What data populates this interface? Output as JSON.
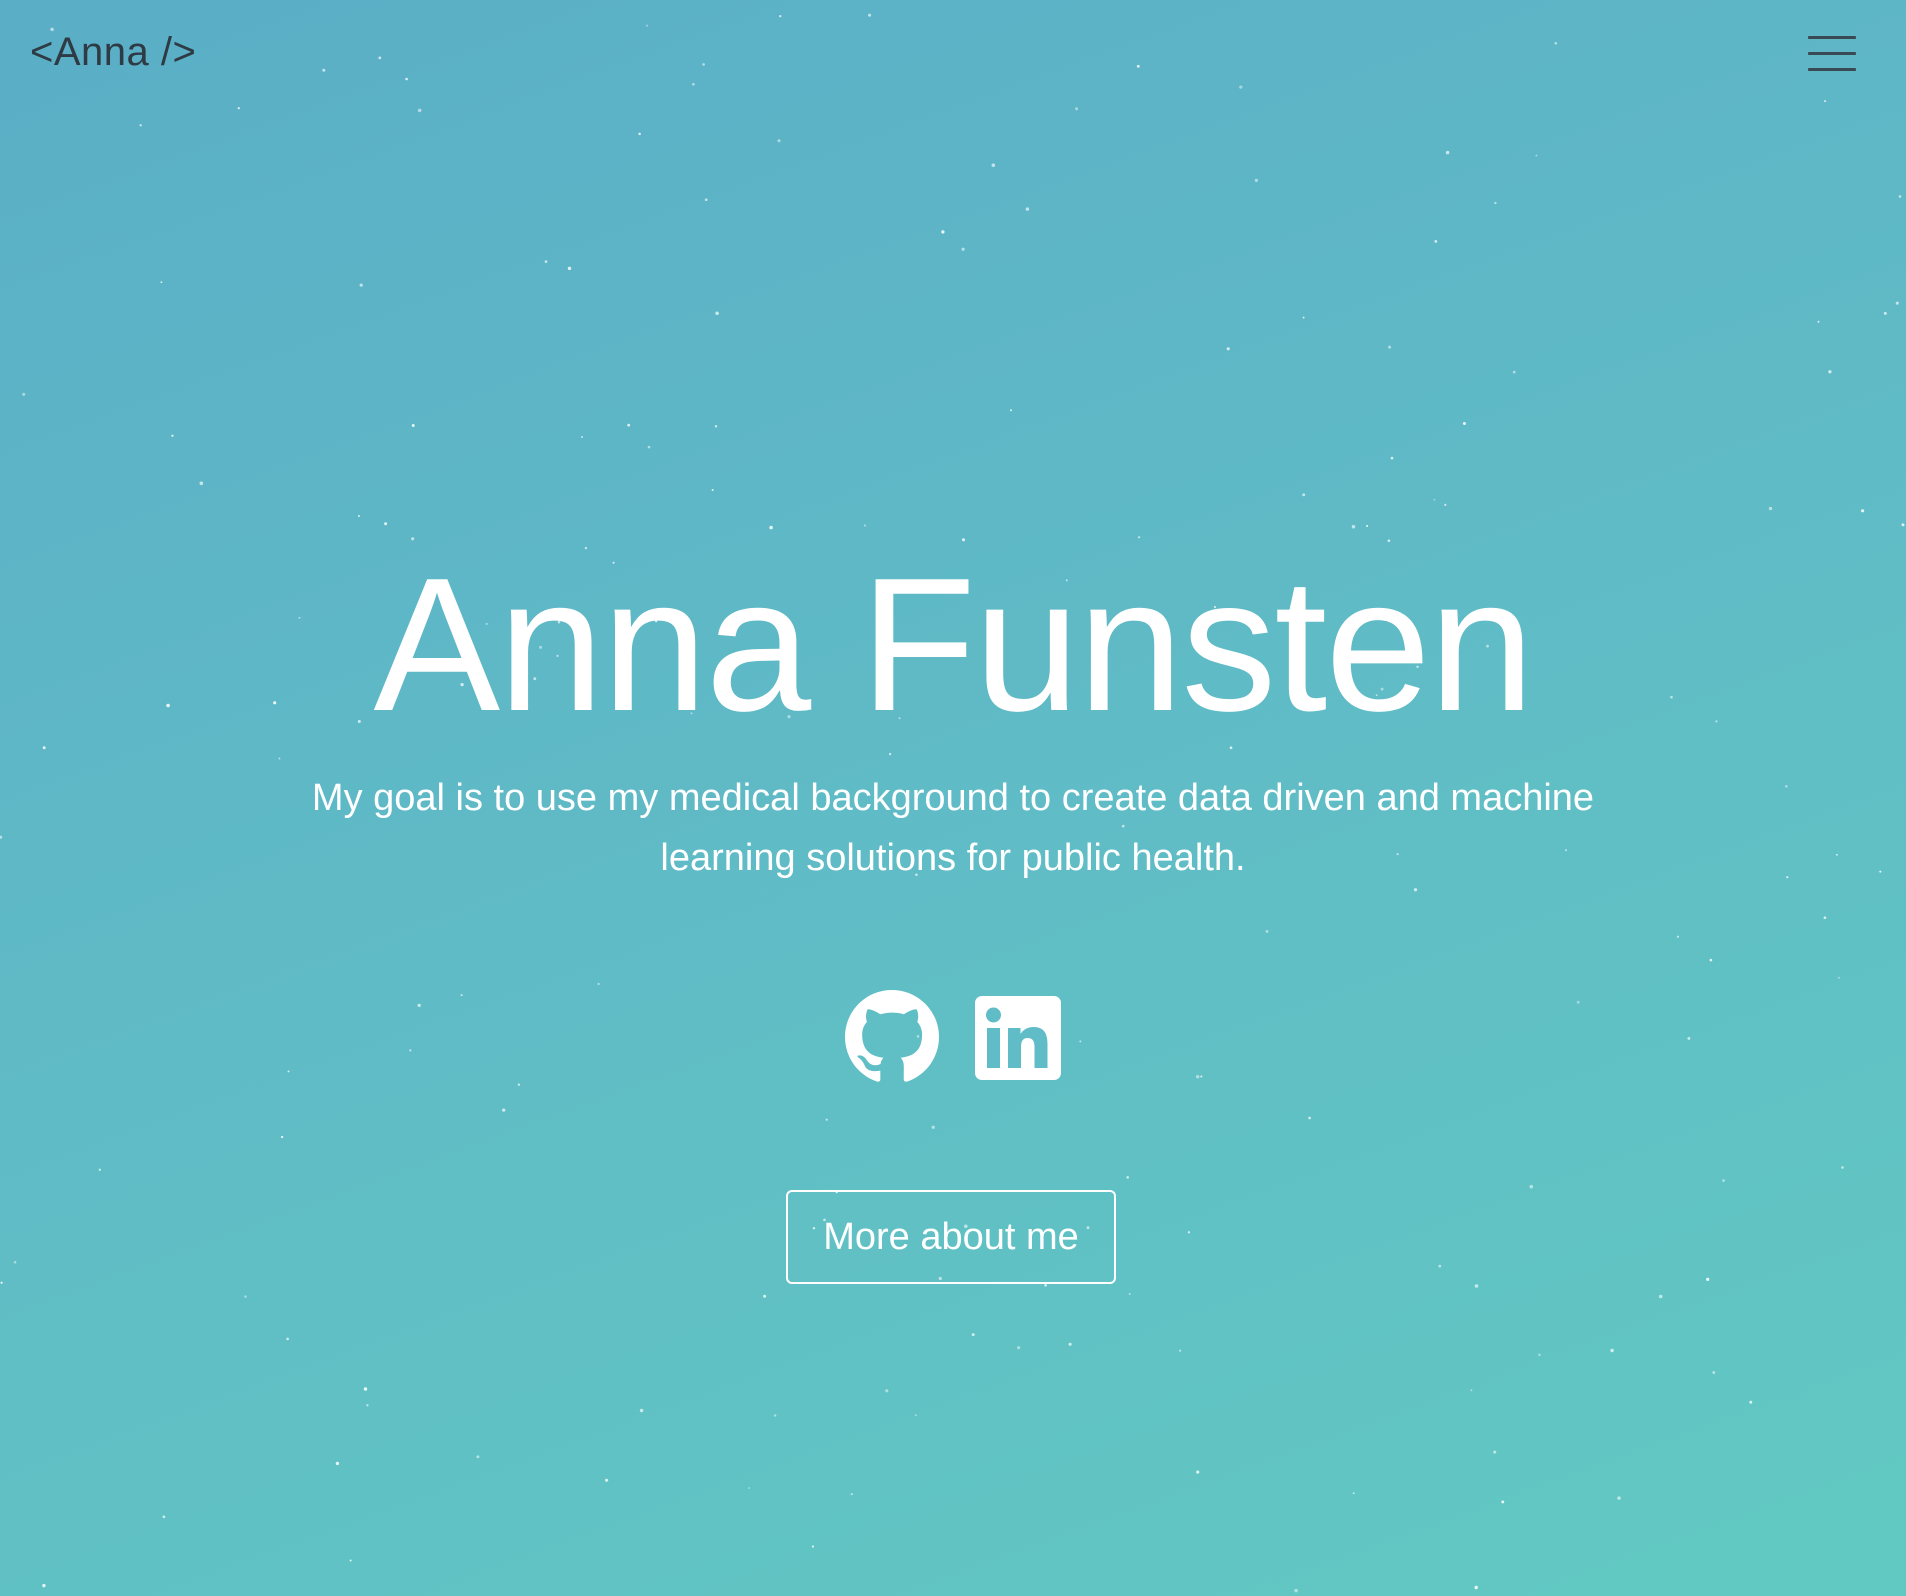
{
  "header": {
    "logo_text": "<Anna />",
    "menu_icon": "hamburger-menu-icon"
  },
  "hero": {
    "name": "Anna Funsten",
    "tagline": "My goal is to use my medical background to create data driven and machine learning solutions for public health.",
    "cta_label": "More about me"
  },
  "socials": [
    {
      "icon": "github-icon"
    },
    {
      "icon": "linkedin-icon"
    }
  ],
  "colors": {
    "gradient_start": "#5aaec6",
    "gradient_end": "#62c9c2",
    "text": "#ffffff",
    "logo_text": "#2e3a44"
  }
}
